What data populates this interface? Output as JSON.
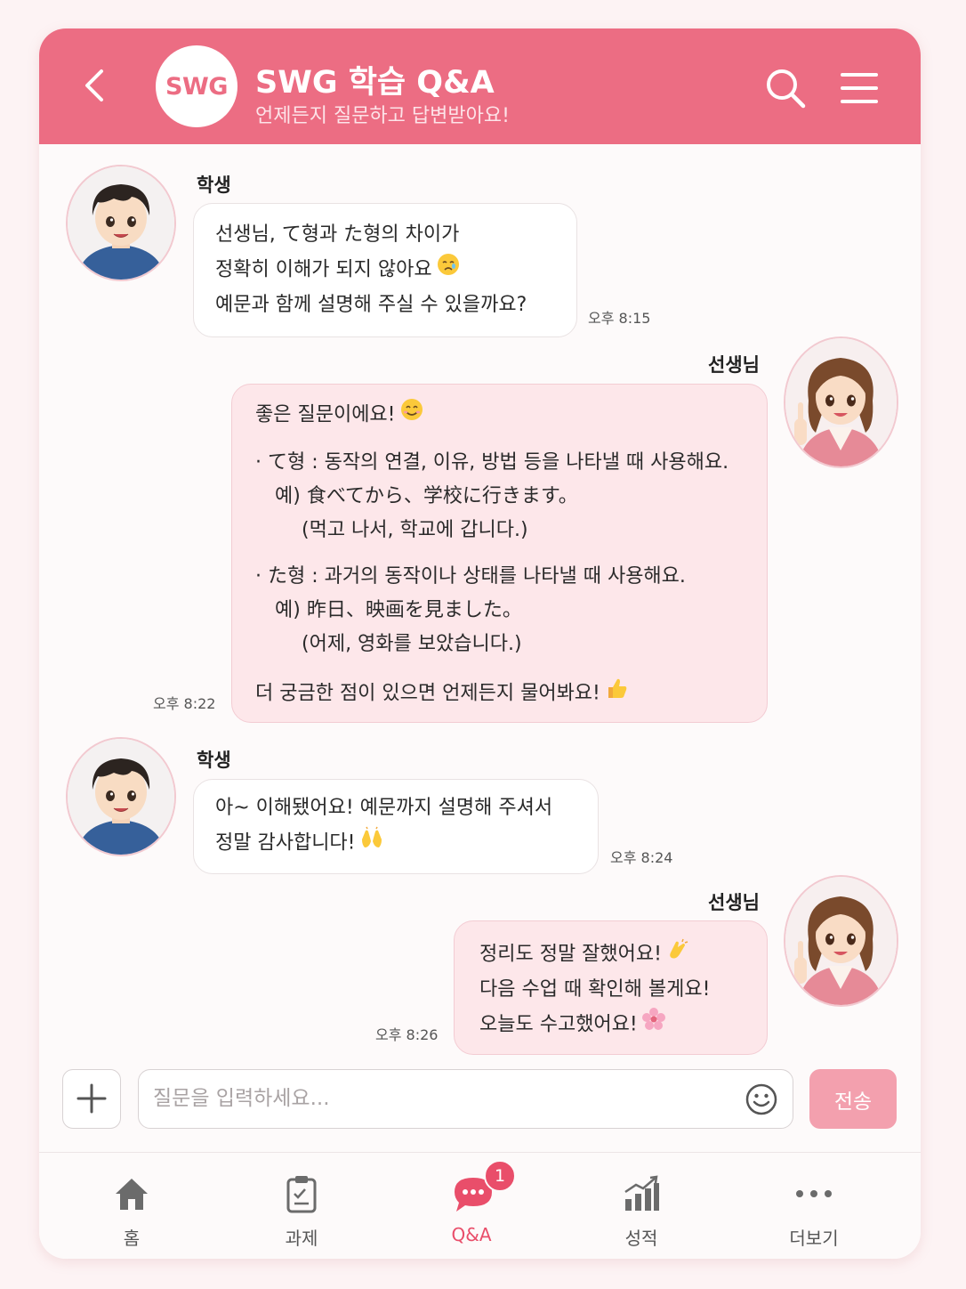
{
  "header": {
    "logo_text": "SWG",
    "title": "SWG 학습 Q&A",
    "subtitle": "언제든지 질문하고 답변받아요!",
    "accent_color": "#ec6d83"
  },
  "messages": [
    {
      "sender": "학생",
      "side": "left",
      "lines": [
        "선생님, て형과 た형의 차이가",
        "정확히 이해가 되지 않아요",
        "예문과 함께 설명해 주실 수 있을까요?"
      ],
      "emoji": "crying-face",
      "time": "오후 8:15"
    },
    {
      "sender": "선생님",
      "side": "right",
      "lines": [
        "좋은 질문이에요!",
        "· て형 : 동작의 연결, 이유, 방법 등을 나타낼 때 사용해요.",
        "예) 食べてから、学校に行きます。",
        "(먹고 나서, 학교에 갑니다.)",
        "· た형 : 과거의 동작이나 상태를 나타낼 때 사용해요.",
        "예) 昨日、映画を見ました。",
        "(어제, 영화를 보았습니다.)",
        "더 궁금한 점이 있으면 언제든지 물어봐요!"
      ],
      "emoji": "smiling-face",
      "time": "오후 8:22"
    },
    {
      "sender": "학생",
      "side": "left",
      "lines": [
        "아~ 이해됐어요! 예문까지 설명해 주셔서",
        "정말 감사합니다!"
      ],
      "emoji": "raised-hands",
      "time": "오후 8:24"
    },
    {
      "sender": "선생님",
      "side": "right",
      "lines": [
        "정리도 정말 잘했어요!",
        "다음 수업 때 확인해 볼게요!",
        "오늘도 수고했어요!"
      ],
      "emoji": "clapping-hands",
      "time": "오후 8:26"
    }
  ],
  "input": {
    "placeholder": "질문을 입력하세요...",
    "send_label": "전송"
  },
  "nav": {
    "items": [
      {
        "label": "홈",
        "icon": "home-icon"
      },
      {
        "label": "과제",
        "icon": "clipboard-icon"
      },
      {
        "label": "Q&A",
        "icon": "chat-bubble-icon",
        "active": true,
        "badge": "1"
      },
      {
        "label": "성적",
        "icon": "bar-chart-icon"
      },
      {
        "label": "더보기",
        "icon": "more-dots-icon"
      }
    ]
  }
}
